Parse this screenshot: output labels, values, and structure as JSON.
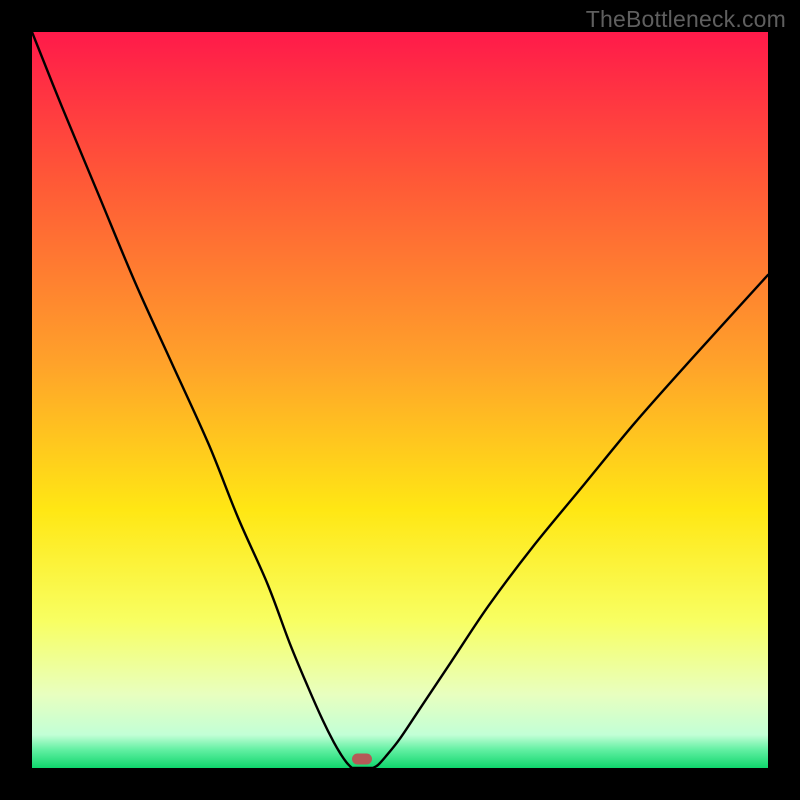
{
  "watermark": "TheBottleneck.com",
  "chart_data": {
    "type": "line",
    "title": "",
    "xlabel": "",
    "ylabel": "",
    "xlim": [
      0,
      100
    ],
    "ylim": [
      0,
      100
    ],
    "gradient_stops": [
      {
        "offset": 0,
        "color": "#ff1a4a"
      },
      {
        "offset": 0.2,
        "color": "#ff5837"
      },
      {
        "offset": 0.45,
        "color": "#ffa22a"
      },
      {
        "offset": 0.65,
        "color": "#ffe714"
      },
      {
        "offset": 0.8,
        "color": "#f8ff62"
      },
      {
        "offset": 0.9,
        "color": "#e8ffbf"
      },
      {
        "offset": 0.955,
        "color": "#c2ffd6"
      },
      {
        "offset": 0.975,
        "color": "#63f0a3"
      },
      {
        "offset": 1.0,
        "color": "#0fd66c"
      }
    ],
    "series": [
      {
        "name": "left-curve",
        "x": [
          0,
          4,
          9,
          14,
          19,
          24,
          28,
          32,
          35,
          37.5,
          39.5,
          41,
          42,
          42.7,
          43.2,
          43.5
        ],
        "y": [
          100,
          90,
          78,
          66,
          55,
          44,
          34,
          25,
          17,
          11,
          6.5,
          3.5,
          1.8,
          0.8,
          0.25,
          0
        ]
      },
      {
        "name": "flat-segment",
        "x": [
          43.5,
          46.3
        ],
        "y": [
          0,
          0
        ]
      },
      {
        "name": "right-curve",
        "x": [
          46.3,
          47,
          48,
          50,
          53,
          57,
          62,
          68,
          75,
          82,
          90,
          100
        ],
        "y": [
          0,
          0.4,
          1.5,
          4,
          8.5,
          14.5,
          22,
          30,
          38.5,
          47,
          56,
          67
        ]
      }
    ],
    "marker": {
      "x": 44.9,
      "y": 1.2,
      "color": "#b55a57"
    }
  }
}
